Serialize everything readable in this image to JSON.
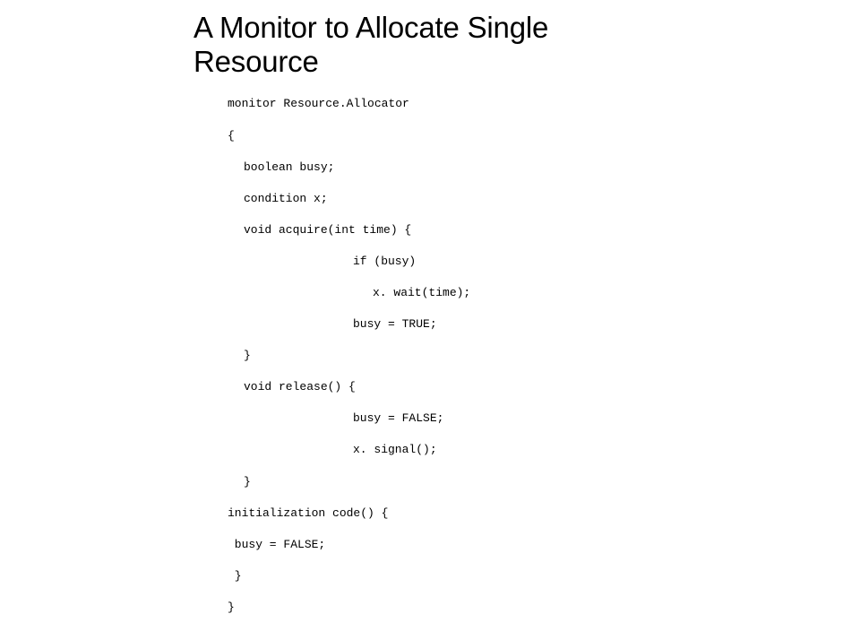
{
  "slide": {
    "title_line1": "A Monitor to Allocate Single",
    "title_line2": "Resource"
  },
  "code": {
    "l00": "monitor Resource.Allocator",
    "l01": "{",
    "l02": "boolean busy;",
    "l03": "condition x;",
    "l04": "void acquire(int time) {",
    "l05": "if (busy)",
    "l06": "x. wait(time);",
    "l07": "busy = TRUE;",
    "l08": "}",
    "l09": "void release() {",
    "l10": "busy = FALSE;",
    "l11": "x. signal();",
    "l12": "}",
    "l13": "initialization code() {",
    "l14": " busy = FALSE;",
    "l15": " }",
    "l16": "}"
  }
}
